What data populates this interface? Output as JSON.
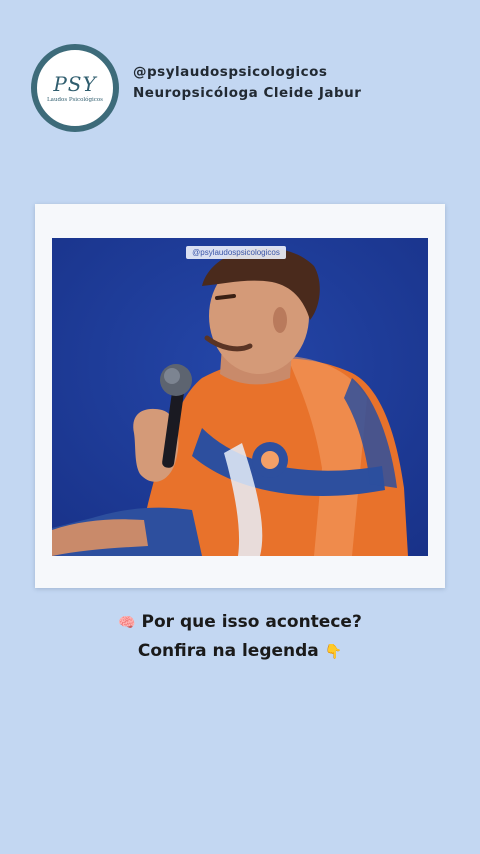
{
  "profile": {
    "logo_text": "PSY",
    "logo_subtext": "Laudos Psicológicos",
    "handle": "@psylaudospsicologicos",
    "subtitle": "Neuropsicóloga Cleide Jabur"
  },
  "post": {
    "image_watermark": "@psylaudospsicologicos",
    "image_icon": "video-frame-icon"
  },
  "caption": {
    "line1_emoji": "🧠",
    "line1_text": "Por que isso acontece?",
    "line2_text": "Confira na legenda",
    "line2_emoji": "👇",
    "line1_emoji_icon": "brain-icon",
    "line2_emoji_icon": "pointing-down-icon"
  },
  "colors": {
    "background": "#c3d7f2",
    "logo_ring": "#3d6b7a",
    "photo_backdrop": "#1f3d9a",
    "shirt_orange": "#e8722b",
    "shirt_blue": "#2d4f9e"
  }
}
